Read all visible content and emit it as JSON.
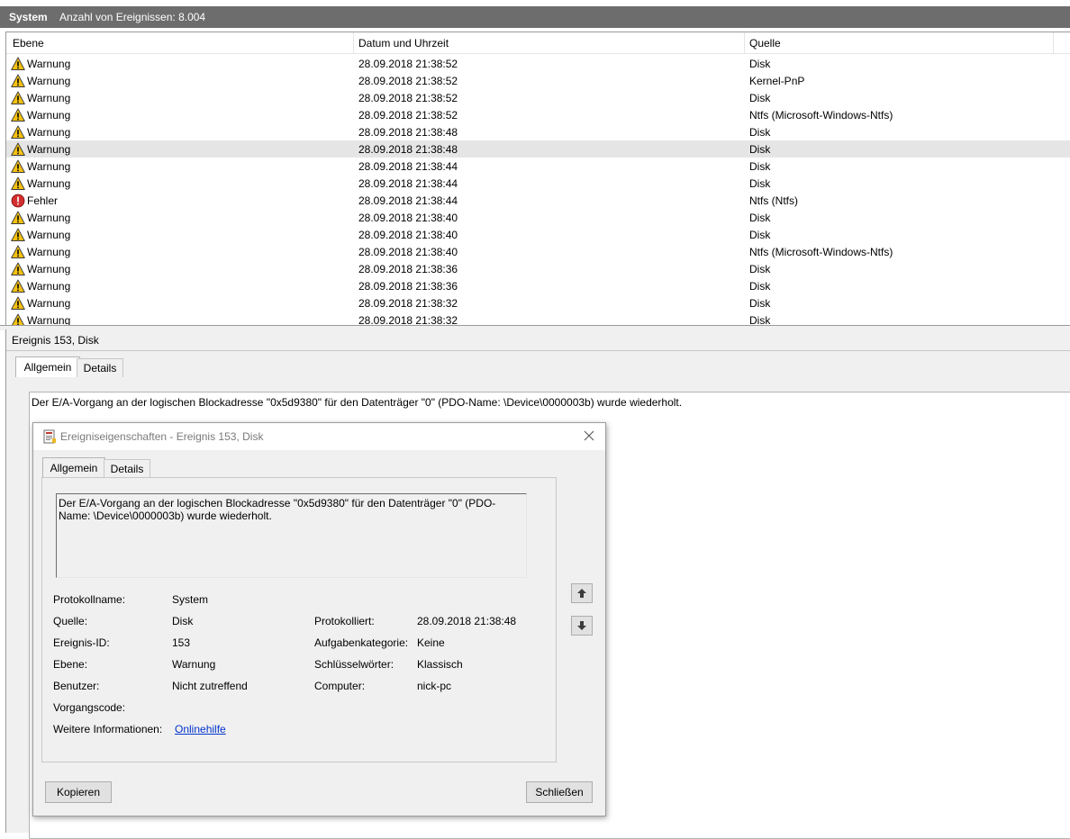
{
  "header": {
    "title": "System",
    "count_label": "Anzahl von Ereignissen: 8.004"
  },
  "columns": {
    "level": "Ebene",
    "datetime": "Datum und Uhrzeit",
    "source": "Quelle"
  },
  "events": [
    {
      "level": "Warnung",
      "icon": "warning-icon",
      "datetime": "28.09.2018 21:38:52",
      "source": "Disk"
    },
    {
      "level": "Warnung",
      "icon": "warning-icon",
      "datetime": "28.09.2018 21:38:52",
      "source": "Kernel-PnP"
    },
    {
      "level": "Warnung",
      "icon": "warning-icon",
      "datetime": "28.09.2018 21:38:52",
      "source": "Disk"
    },
    {
      "level": "Warnung",
      "icon": "warning-icon",
      "datetime": "28.09.2018 21:38:52",
      "source": "Ntfs (Microsoft-Windows-Ntfs)"
    },
    {
      "level": "Warnung",
      "icon": "warning-icon",
      "datetime": "28.09.2018 21:38:48",
      "source": "Disk"
    },
    {
      "level": "Warnung",
      "icon": "warning-icon",
      "datetime": "28.09.2018 21:38:48",
      "source": "Disk",
      "selected": true
    },
    {
      "level": "Warnung",
      "icon": "warning-icon",
      "datetime": "28.09.2018 21:38:44",
      "source": "Disk"
    },
    {
      "level": "Warnung",
      "icon": "warning-icon",
      "datetime": "28.09.2018 21:38:44",
      "source": "Disk"
    },
    {
      "level": "Fehler",
      "icon": "error-icon",
      "datetime": "28.09.2018 21:38:44",
      "source": "Ntfs (Ntfs)"
    },
    {
      "level": "Warnung",
      "icon": "warning-icon",
      "datetime": "28.09.2018 21:38:40",
      "source": "Disk"
    },
    {
      "level": "Warnung",
      "icon": "warning-icon",
      "datetime": "28.09.2018 21:38:40",
      "source": "Disk"
    },
    {
      "level": "Warnung",
      "icon": "warning-icon",
      "datetime": "28.09.2018 21:38:40",
      "source": "Ntfs (Microsoft-Windows-Ntfs)"
    },
    {
      "level": "Warnung",
      "icon": "warning-icon",
      "datetime": "28.09.2018 21:38:36",
      "source": "Disk"
    },
    {
      "level": "Warnung",
      "icon": "warning-icon",
      "datetime": "28.09.2018 21:38:36",
      "source": "Disk"
    },
    {
      "level": "Warnung",
      "icon": "warning-icon",
      "datetime": "28.09.2018 21:38:32",
      "source": "Disk"
    },
    {
      "level": "Warnung",
      "icon": "warning-icon",
      "datetime": "28.09.2018 21:38:32",
      "source": "Disk"
    }
  ],
  "detail": {
    "title": "Ereignis 153, Disk",
    "tabs": [
      "Allgemein",
      "Details"
    ],
    "message": "Der E/A-Vorgang an der logischen Blockadresse \"0x5d9380\" für den Datenträger \"0\" (PDO-Name: \\Device\\0000003b) wurde wiederholt."
  },
  "dialog": {
    "title": "Ereigniseigenschaften - Ereignis 153, Disk",
    "tabs": [
      "Allgemein",
      "Details"
    ],
    "description": "Der E/A-Vorgang an der logischen Blockadresse \"0x5d9380\" für den Datenträger \"0\" (PDO-Name: \\Device\\0000003b) wurde wiederholt.",
    "fields": {
      "protokollname": {
        "label": "Protokollname:",
        "value": "System"
      },
      "quelle": {
        "label": "Quelle:",
        "value": "Disk"
      },
      "protokolliert": {
        "label": "Protokolliert:",
        "value": "28.09.2018 21:38:48"
      },
      "ereignis_id": {
        "label": "Ereignis-ID:",
        "value": "153"
      },
      "aufgabenkategorie": {
        "label": "Aufgabenkategorie:",
        "value": "Keine"
      },
      "ebene": {
        "label": "Ebene:",
        "value": "Warnung"
      },
      "schluesselwoerter": {
        "label": "Schlüsselwörter:",
        "value": "Klassisch"
      },
      "benutzer": {
        "label": "Benutzer:",
        "value": "Nicht zutreffend"
      },
      "computer": {
        "label": "Computer:",
        "value": "nick-pc"
      },
      "vorgangscode": {
        "label": "Vorgangscode:",
        "value": ""
      },
      "weitere_informationen": {
        "label": "Weitere Informationen:",
        "value": "Onlinehilfe"
      }
    },
    "buttons": {
      "copy": "Kopieren",
      "close": "Schließen"
    }
  }
}
